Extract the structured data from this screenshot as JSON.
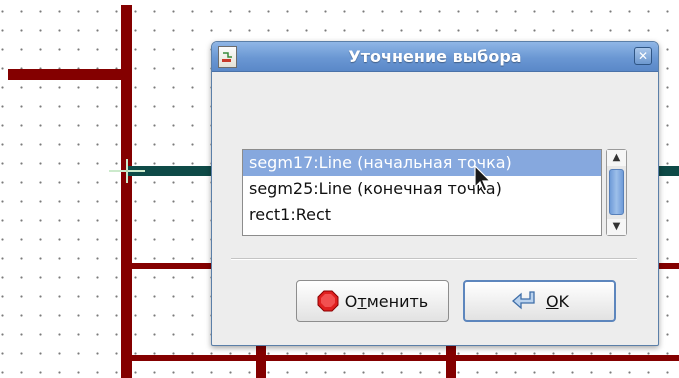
{
  "dialog": {
    "title": "Уточнение выбора",
    "close_icon": "close-icon",
    "app_icon": "app-icon"
  },
  "selection_list": {
    "items": [
      {
        "label": "segm17:Line (начальная точка)",
        "selected": true
      },
      {
        "label": "segm25:Line (конечная точка)",
        "selected": false
      },
      {
        "label": "rect1:Rect",
        "selected": false
      }
    ]
  },
  "buttons": {
    "cancel": {
      "label_before": "О",
      "label_mnemonic": "т",
      "label_after": "менить",
      "icon": "stop-icon"
    },
    "ok": {
      "label_mnemonic": "O",
      "label_after": "K",
      "icon": "return-arrow-icon"
    }
  },
  "colors": {
    "wire": "#840000",
    "bus": "#0e4a47",
    "titlebar": "#6a97d3",
    "selection": "#86a8de"
  }
}
